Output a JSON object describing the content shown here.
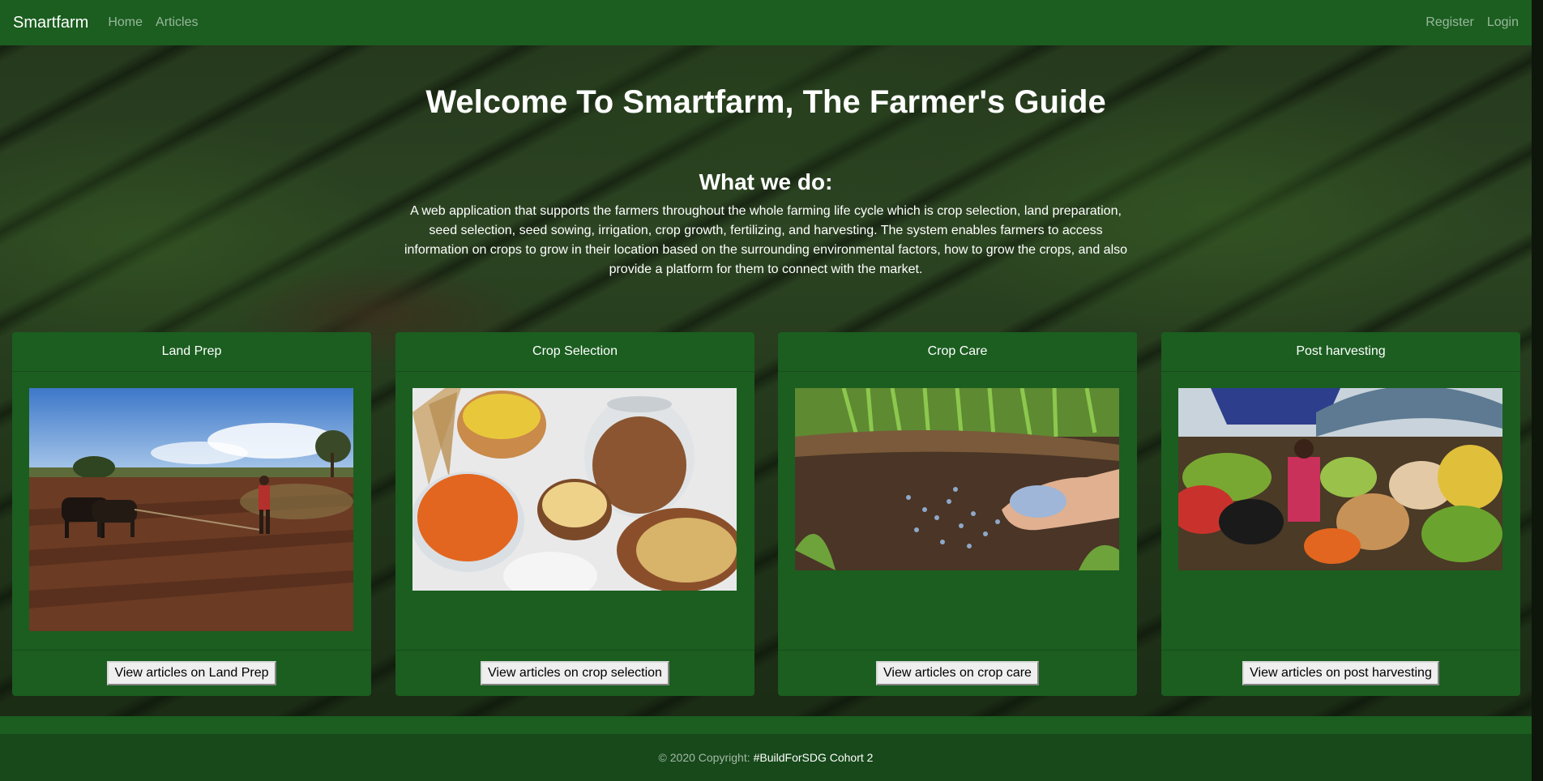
{
  "navbar": {
    "brand": "Smartfarm",
    "links": [
      "Home",
      "Articles"
    ],
    "right_links": [
      "Register",
      "Login"
    ],
    "background_color": "#1b5e20"
  },
  "hero": {
    "title": "Welcome To Smartfarm, The Farmer's Guide",
    "subtitle": "What we do:",
    "description": "A web application that supports the farmers throughout the whole farming life cycle which is crop selection, land preparation, seed selection, seed sowing, irrigation, crop growth, fertilizing, and harvesting. The system enables farmers to access information on crops to grow in their location based on the surrounding environmental factors, how to grow the crops, and also provide a platform for them to connect with the market."
  },
  "cards": [
    {
      "title": "Land Prep",
      "button": "View articles on Land Prep"
    },
    {
      "title": "Crop Selection",
      "button": "View articles on crop selection"
    },
    {
      "title": "Crop Care",
      "button": "View articles on crop care"
    },
    {
      "title": "Post harvesting",
      "button": "View articles on post harvesting"
    }
  ],
  "footer": {
    "copyright": "© 2020 Copyright:",
    "org": "#BuildForSDG Cohort 2"
  }
}
